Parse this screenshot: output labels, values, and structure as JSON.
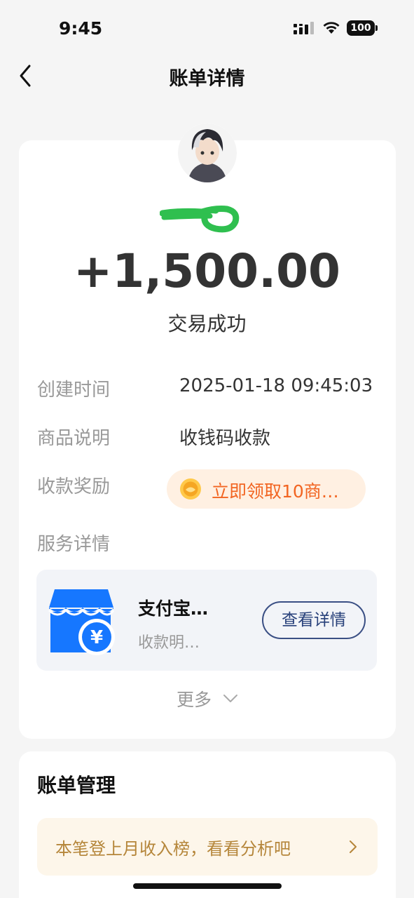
{
  "status_bar": {
    "time": "9:45",
    "battery": "100"
  },
  "nav": {
    "title": "账单详情"
  },
  "transaction": {
    "amount": "+1,500.00",
    "status": "交易成功"
  },
  "details": {
    "created_label": "创建时间",
    "created_value": "2025-01-18 09:45:03",
    "item_label": "商品说明",
    "item_value": "收钱码收款",
    "reward_label": "收款奖励",
    "reward_value": "立即领取10商…",
    "service_label": "服务详情"
  },
  "service": {
    "name": "支付宝…",
    "subtitle": "收款明…",
    "button": "查看详情",
    "more": "更多"
  },
  "bill_management": {
    "title": "账单管理",
    "banner": "本笔登上月收入榜，看看分析吧"
  },
  "colors": {
    "accent_blue": "#1677ff",
    "reward_orange": "#f26522",
    "banner_gold": "#b5863a"
  }
}
